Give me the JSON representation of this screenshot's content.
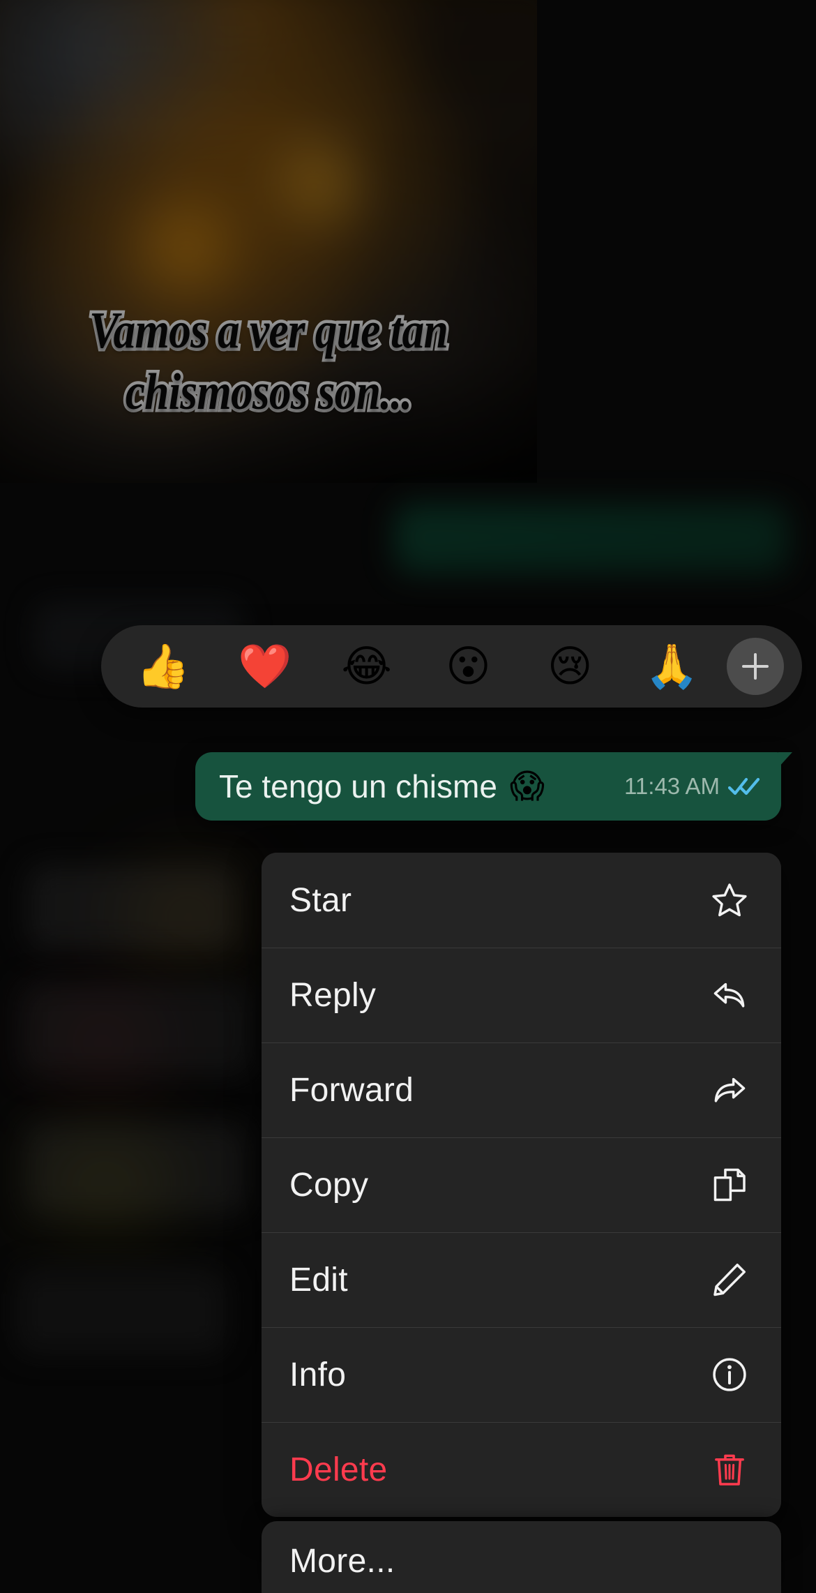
{
  "media": {
    "caption_line1": "Vamos a ver que tan",
    "caption_line2": "chismosos son..."
  },
  "reactions": {
    "emojis": [
      {
        "name": "thumbs-up-emoji",
        "glyph": "👍"
      },
      {
        "name": "red-heart-emoji",
        "glyph": "❤️"
      },
      {
        "name": "tears-of-joy-emoji",
        "glyph": "😂"
      },
      {
        "name": "open-mouth-emoji",
        "glyph": "😮"
      },
      {
        "name": "crying-face-emoji",
        "glyph": "😢"
      },
      {
        "name": "folded-hands-emoji",
        "glyph": "🙏"
      }
    ],
    "add_more_label": "+"
  },
  "message": {
    "text": "Te tengo un chisme",
    "emoji": "😱",
    "time": "11:43 AM",
    "status": "read",
    "bubble_color": "#17533e",
    "tick_color": "#53bdeb"
  },
  "context_menu": {
    "items": [
      {
        "label": "Star",
        "icon": "star-icon",
        "destructive": false
      },
      {
        "label": "Reply",
        "icon": "reply-icon",
        "destructive": false
      },
      {
        "label": "Forward",
        "icon": "forward-icon",
        "destructive": false
      },
      {
        "label": "Copy",
        "icon": "copy-icon",
        "destructive": false
      },
      {
        "label": "Edit",
        "icon": "pencil-icon",
        "destructive": false
      },
      {
        "label": "Info",
        "icon": "info-icon",
        "destructive": false
      },
      {
        "label": "Delete",
        "icon": "trash-icon",
        "destructive": true
      }
    ],
    "more_label": "More...",
    "destructive_color": "#ff3b4e",
    "surface_color": "#242424"
  }
}
